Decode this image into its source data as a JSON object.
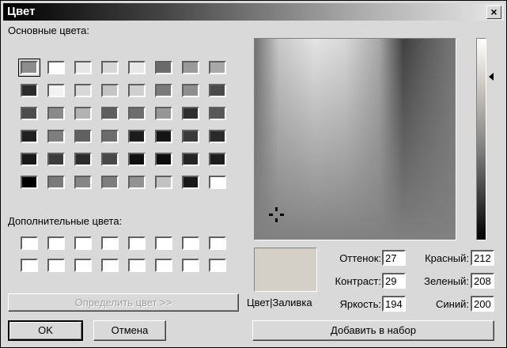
{
  "window": {
    "title": "Цвет",
    "close_glyph": "×"
  },
  "basic": {
    "label": "Основные цвета:",
    "rows": [
      [
        "#8c8c8c",
        "#fdfdfd",
        "#e6e6e6",
        "#d6d6d6",
        "#e8e8e8",
        "#6a6a6a",
        "#9a9a9a",
        "#a8a8a8"
      ],
      [
        "#2c2c2c",
        "#f2f2f2",
        "#d8d8d8",
        "#c4c4c4",
        "#cfcfcf",
        "#7a7a7a",
        "#8e8e8e",
        "#4a4a4a"
      ],
      [
        "#4c4c4c",
        "#8a8a8a",
        "#b2b2b2",
        "#5e5e5e",
        "#6e6e6e",
        "#969696",
        "#2e2e2e",
        "#585858"
      ],
      [
        "#202020",
        "#7e7e7e",
        "#606060",
        "#6c6c6c",
        "#1c1c1c",
        "#141414",
        "#3a3a3a",
        "#2a2a2a"
      ],
      [
        "#1a1a1a",
        "#3c3c3c",
        "#2c2c2c",
        "#484848",
        "#101010",
        "#0c0c0c",
        "#242424",
        "#1e1e1e"
      ],
      [
        "#000000",
        "#7a7a7a",
        "#868686",
        "#7e7e7e",
        "#929292",
        "#c2c2c2",
        "#181818",
        "#ffffff"
      ]
    ]
  },
  "custom": {
    "label": "Дополнительные цвета:",
    "rows": [
      [
        "#ffffff",
        "#ffffff",
        "#ffffff",
        "#ffffff",
        "#ffffff",
        "#ffffff",
        "#ffffff",
        "#ffffff"
      ],
      [
        "#ffffff",
        "#ffffff",
        "#ffffff",
        "#ffffff",
        "#ffffff",
        "#ffffff",
        "#ffffff",
        "#ffffff"
      ]
    ]
  },
  "buttons": {
    "define": "Определить цвет >>",
    "ok": "OK",
    "cancel": "Отмена",
    "add": "Добавить в набор"
  },
  "preview": {
    "label": "Цвет|Заливка",
    "color": "#d4d0c8"
  },
  "fields": {
    "hue": {
      "label": "Оттенок:",
      "value": "27"
    },
    "sat": {
      "label": "Контраст:",
      "value": "29"
    },
    "lum": {
      "label": "Яркость:",
      "value": "194"
    },
    "red": {
      "label": "Красный:",
      "value": "212"
    },
    "green": {
      "label": "Зеленый:",
      "value": "208"
    },
    "blue": {
      "label": "Синий:",
      "value": "200"
    }
  }
}
